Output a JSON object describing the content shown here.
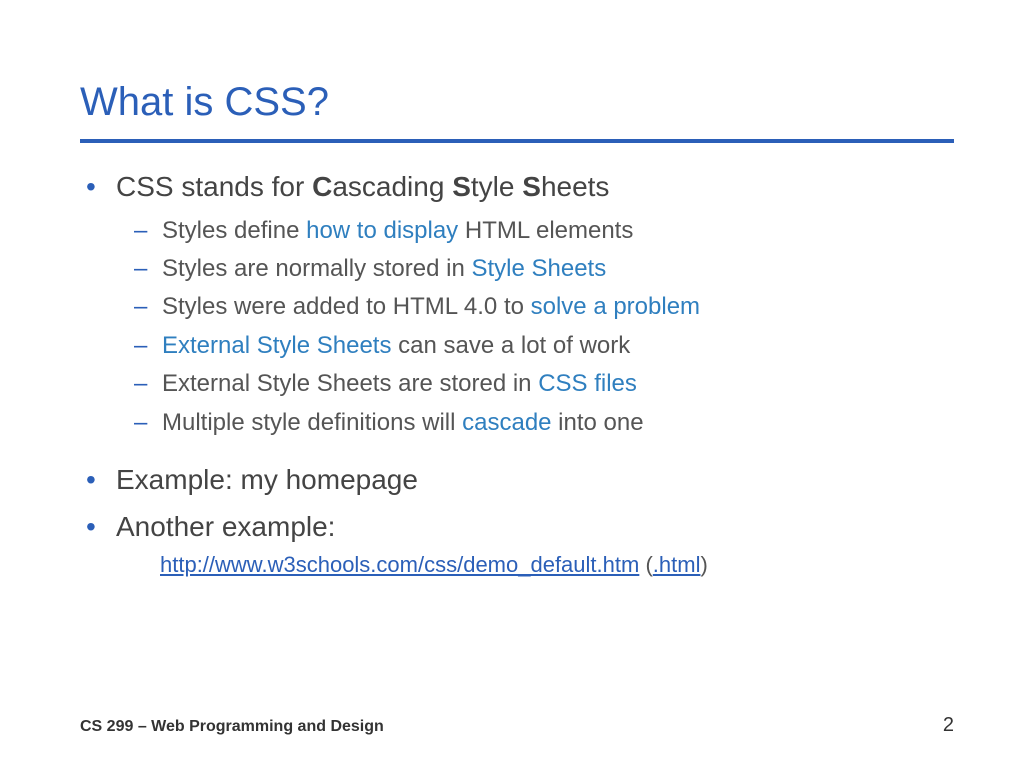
{
  "title": "What is CSS?",
  "bullets": {
    "b1": {
      "pre": "CSS stands for ",
      "c": "C",
      "ascading": "ascading ",
      "s1": "S",
      "tyle": "tyle ",
      "s2": "S",
      "heets": "heets"
    },
    "sub": {
      "s1a": "Styles define ",
      "s1b": "how to display",
      "s1c": " HTML elements",
      "s2a": "Styles are normally stored in ",
      "s2b": "Style Sheets",
      "s3a": "Styles were added to HTML 4.0 to ",
      "s3b": "solve a problem",
      "s4a": "External Style Sheets",
      "s4b": " can save a lot of work",
      "s5a": "External Style Sheets are stored in ",
      "s5b": "CSS files",
      "s6a": "Multiple style definitions will ",
      "s6b": "cascade",
      "s6c": " into one"
    },
    "b2": "Example: my homepage",
    "b3": "Another example:",
    "link_url": "http://www.w3schools.com/css/demo_default.htm",
    "link_paren_open": " (",
    "link_html": ".html",
    "link_paren_close": ")"
  },
  "footer": {
    "course": "CS 299 – Web Programming and Design",
    "page": "2"
  }
}
